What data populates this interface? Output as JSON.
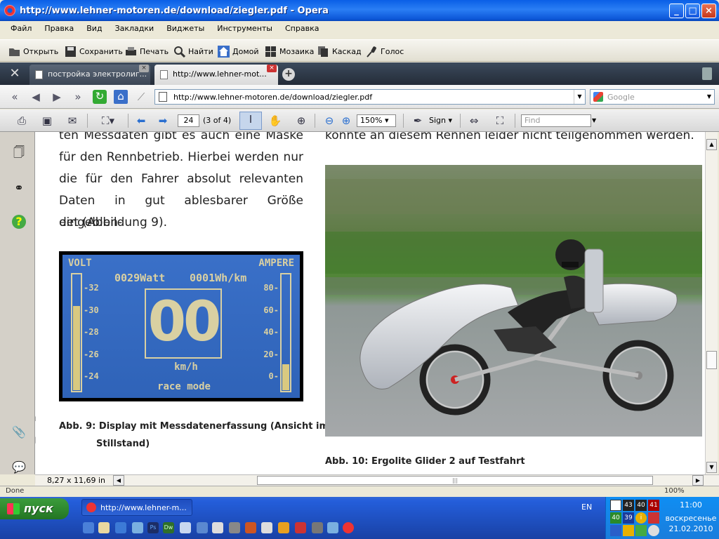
{
  "window": {
    "title": "http://www.lehner-motoren.de/download/ziegler.pdf - Opera",
    "controls": {
      "minimize": "_",
      "maximize": "□",
      "close": "×"
    }
  },
  "menu": [
    "Файл",
    "Правка",
    "Вид",
    "Закладки",
    "Виджеты",
    "Инструменты",
    "Справка"
  ],
  "toolbar": {
    "open": "Открыть",
    "save": "Сохранить",
    "print": "Печать",
    "find": "Найти",
    "home": "Домой",
    "tile": "Мозаика",
    "cascade": "Каскад",
    "voice": "Голос"
  },
  "tabs": [
    {
      "label": "постройка электролиг..."
    },
    {
      "label": "http://www.lehner-mot..."
    }
  ],
  "address": {
    "url": "http://www.lehner-motoren.de/download/ziegler.pdf",
    "search_placeholder": "Google"
  },
  "pdf_toolbar": {
    "page_number": "24",
    "page_of": "(3 of 4)",
    "zoom": "150%",
    "sign": "Sign",
    "find_placeholder": "Find"
  },
  "document": {
    "left_paragraph_lines": [
      "ten Messdaten gibt es auch eine Maske",
      "für den Rennbetrieb. Hierbei werden nur",
      "die für den Fahrer absolut relevanten",
      "Daten in gut ablesbarer Größe eingeblen-",
      "det (Abbildung 9)."
    ],
    "right_top_line": "konnte an diesem Rennen leider nicht teilgenommen werden.",
    "caption9_line1": "Abb. 9:  Display mit Messdatenerfassung (Ansicht im",
    "caption9_line2": "Stillstand)",
    "caption10": "Abb. 10:  Ergolite Glider 2  auf Testfahrt",
    "margin_letters": [
      "n",
      "g",
      "r"
    ]
  },
  "lcd": {
    "volt_label": "VOLT",
    "ampere_label": "AMPERE",
    "watt": "0029Watt",
    "wh": "0001Wh/km",
    "speed": "00",
    "unit": "km/h",
    "mode": "race mode",
    "volt_ticks": [
      "32",
      "30",
      "28",
      "26",
      "24"
    ],
    "amp_ticks": [
      "80",
      "60",
      "40",
      "20",
      "0"
    ],
    "volt_level": 0.72,
    "amp_level": 0.22
  },
  "bottom": {
    "page_size": "8,27 x 11,69 in",
    "status": "Done",
    "zoom": "100%"
  },
  "taskbar": {
    "start": "пуск",
    "task": "http://www.lehner-m...",
    "lang": "EN",
    "tray_numbers": [
      "43",
      "40",
      "41",
      "40",
      "39"
    ],
    "time": "11:00",
    "day": "воскресенье",
    "date": "21.02.2010"
  }
}
